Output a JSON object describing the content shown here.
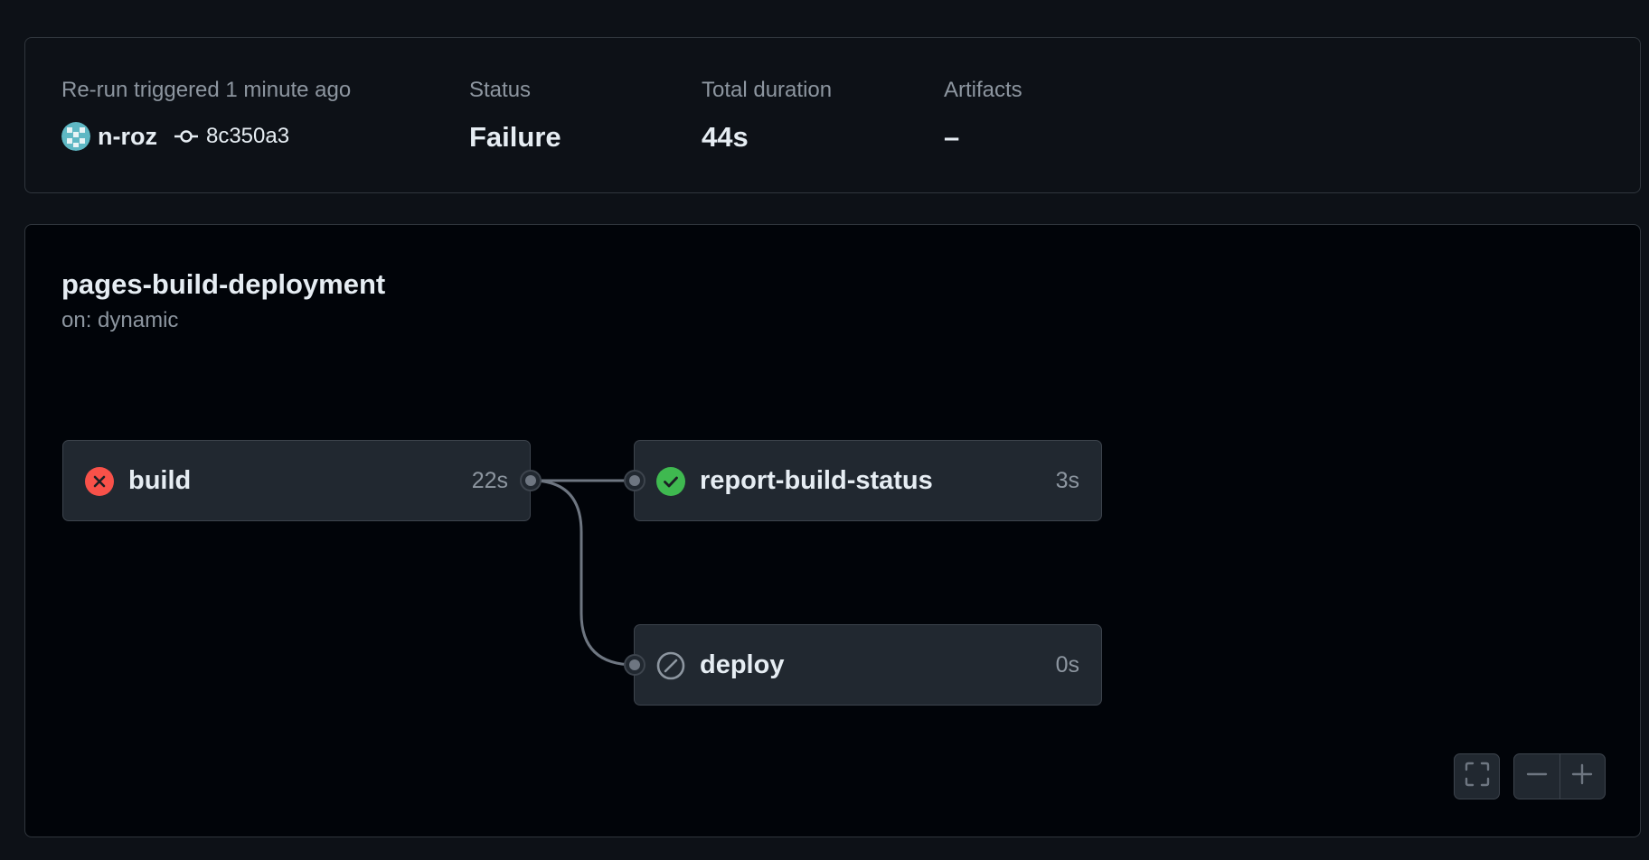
{
  "summary": {
    "trigger_label": "Re-run triggered 1 minute ago",
    "actor": "n-roz",
    "commit": "8c350a3",
    "status_label": "Status",
    "status_value": "Failure",
    "duration_label": "Total duration",
    "duration_value": "44s",
    "artifacts_label": "Artifacts",
    "artifacts_value": "–"
  },
  "workflow": {
    "name": "pages-build-deployment",
    "trigger": "on: dynamic"
  },
  "jobs": [
    {
      "name": "build",
      "duration": "22s",
      "status": "failure",
      "icon": "x-circle-fill-icon",
      "color": "#f85149"
    },
    {
      "name": "report-build-status",
      "duration": "3s",
      "status": "success",
      "icon": "check-circle-fill-icon",
      "color": "#3fb950"
    },
    {
      "name": "deploy",
      "duration": "0s",
      "status": "skipped",
      "icon": "skip-icon",
      "color": "#8d96a0"
    }
  ],
  "controls": {
    "fullscreen_icon": "screen-full-icon",
    "zoom_out_icon": "minus-icon",
    "zoom_in_icon": "plus-icon"
  },
  "colors": {
    "background": "#0d1117",
    "canvas": "#010409",
    "border": "#30363d",
    "job_bg": "#212830",
    "failure": "#f85149",
    "success": "#3fb950",
    "muted": "#8d96a0"
  }
}
